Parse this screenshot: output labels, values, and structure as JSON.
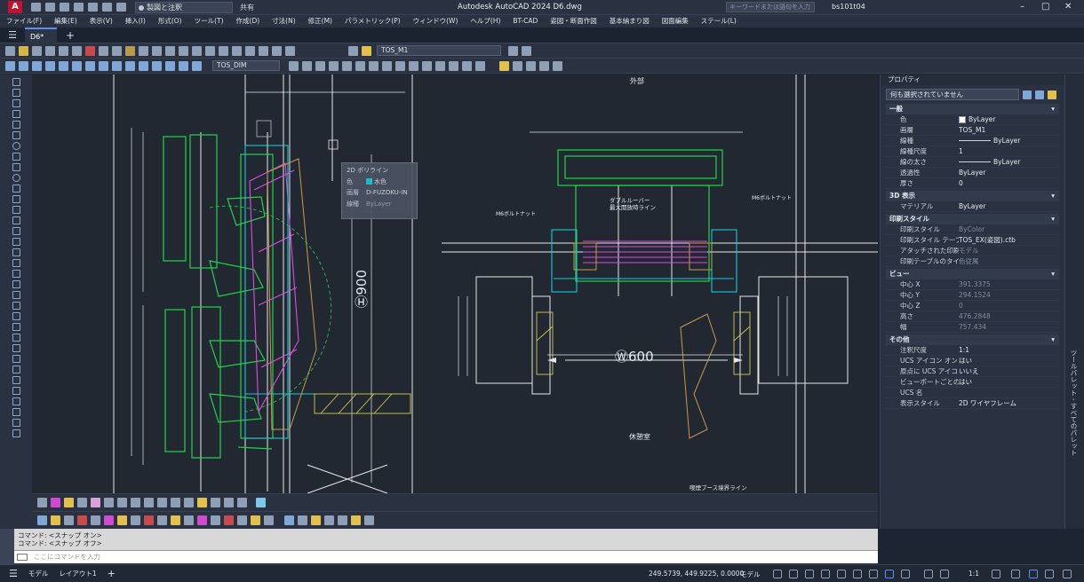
{
  "titlebar": {
    "workspace": "製図と注釈",
    "share": "共有",
    "title": "Autodesk AutoCAD 2024   D6.dwg",
    "search_placeholder": "キーワードまたは語句を入力",
    "user": "bs101t04"
  },
  "menus": [
    "ファイル(F)",
    "編集(E)",
    "表示(V)",
    "挿入(I)",
    "形式(O)",
    "ツール(T)",
    "作成(D)",
    "寸法(N)",
    "修正(M)",
    "パラメトリック(P)",
    "ウィンドウ(W)",
    "ヘルプ(H)",
    "BT-CAD",
    "姿図・断面作図",
    "基本納まり図",
    "図面編集",
    "ステール(L)"
  ],
  "tabs": {
    "file": "D6*",
    "add": "+"
  },
  "toolbar": {
    "layer": "TOS_M1",
    "dimstyle": "TOS_DIM"
  },
  "tooltip": {
    "title": "2D ポリライン",
    "rows": [
      {
        "k": "色",
        "v": "水色"
      },
      {
        "k": "画層",
        "v": "D-FUZOKU-IN"
      },
      {
        "k": "線種",
        "v": "ByLayer"
      }
    ]
  },
  "canvas": {
    "label_outside": "外部",
    "label_rest": "休憩室",
    "label_600": "600",
    "label_900": "900",
    "label_boothline": "喫煙ブース境界ライン",
    "label_louver": "ダブルルーバー\n最大開放時ライン",
    "label_bolt_l": "M6ボルトナット",
    "label_bolt_r": "M6ボルトナット"
  },
  "properties": {
    "header": "プロパティ",
    "selection": "何も選択されていません",
    "sections": [
      {
        "name": "一般",
        "rows": [
          {
            "k": "色",
            "v": "ByLayer",
            "swatch": true
          },
          {
            "k": "画層",
            "v": "TOS_M1"
          },
          {
            "k": "線種",
            "v": "ByLayer",
            "line": true
          },
          {
            "k": "線種尺度",
            "v": "1"
          },
          {
            "k": "線の太さ",
            "v": "ByLayer",
            "line": true
          },
          {
            "k": "透過性",
            "v": "ByLayer"
          },
          {
            "k": "厚さ",
            "v": "0"
          }
        ]
      },
      {
        "name": "3D 表示",
        "rows": [
          {
            "k": "マテリアル",
            "v": "ByLayer"
          }
        ]
      },
      {
        "name": "印刷スタイル",
        "rows": [
          {
            "k": "印刷スタイル",
            "v": "ByColor",
            "dim": true
          },
          {
            "k": "印刷スタイル テーブル",
            "v": "TOS_EX(姿図).ctb"
          },
          {
            "k": "アタッチされた印刷テーブル",
            "v": "モデル",
            "dim": true
          },
          {
            "k": "印刷テーブルのタイプ",
            "v": "色従属",
            "dim": true
          }
        ]
      },
      {
        "name": "ビュー",
        "rows": [
          {
            "k": "中心 X",
            "v": "391.3375",
            "dim": true
          },
          {
            "k": "中心 Y",
            "v": "294.1524",
            "dim": true
          },
          {
            "k": "中心 Z",
            "v": "0",
            "dim": true
          },
          {
            "k": "高さ",
            "v": "476.2848",
            "dim": true
          },
          {
            "k": "幅",
            "v": "757.434",
            "dim": true
          }
        ]
      },
      {
        "name": "その他",
        "rows": [
          {
            "k": "注釈尺度",
            "v": "1:1"
          },
          {
            "k": "UCS アイコン オン",
            "v": "はい"
          },
          {
            "k": "原点に UCS アイコン",
            "v": "いいえ"
          },
          {
            "k": "ビューポートごとの UCS",
            "v": "はい"
          },
          {
            "k": "UCS 名",
            "v": ""
          },
          {
            "k": "表示スタイル",
            "v": "2D ワイヤフレーム"
          }
        ]
      }
    ]
  },
  "side_label": "ツールパレット - すべてのパレット",
  "command": {
    "history": [
      "コマンド:  <スナップ オン>",
      "コマンド:  <スナップ オフ>"
    ],
    "placeholder": "ここにコマンドを入力"
  },
  "status": {
    "model_tab": "モデル",
    "layout_tab": "レイアウト1",
    "coords": "249.5739, 449.9225, 0.0000",
    "model": "モデル",
    "scale": "1:1"
  }
}
